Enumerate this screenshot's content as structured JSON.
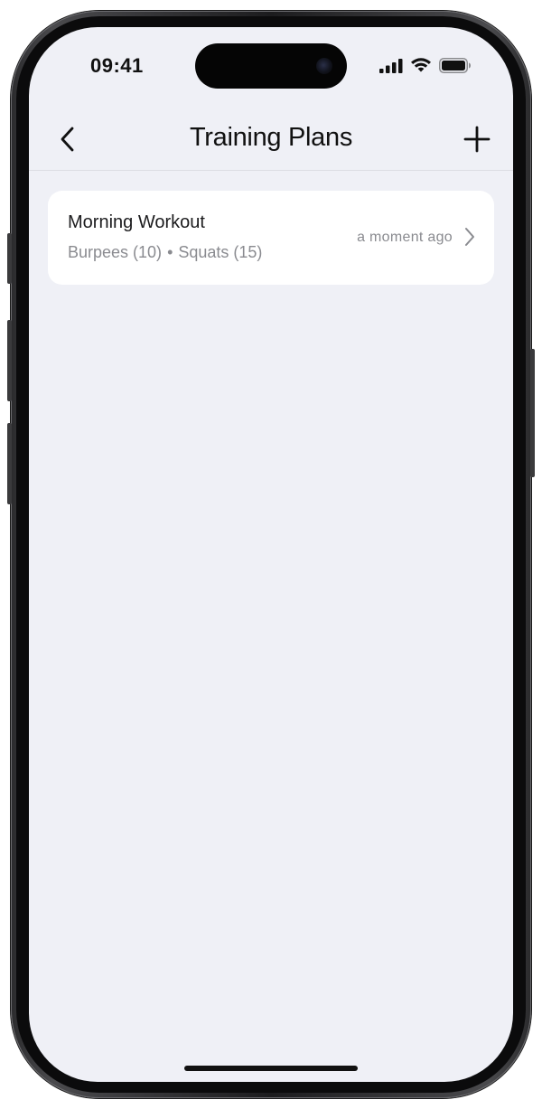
{
  "status_bar": {
    "time": "09:41"
  },
  "nav": {
    "title": "Training Plans",
    "back_icon": "chevron-left-icon",
    "add_icon": "plus-icon"
  },
  "plans": [
    {
      "name": "Morning Workout",
      "exercises": [
        "Burpees (10)",
        "Squats (15)"
      ],
      "separator": "•",
      "updated": "a moment ago"
    }
  ],
  "colors": {
    "screen_background": "#eff0f6",
    "card_background": "#ffffff",
    "primary_text": "#111111",
    "secondary_text": "#8a8b90"
  }
}
